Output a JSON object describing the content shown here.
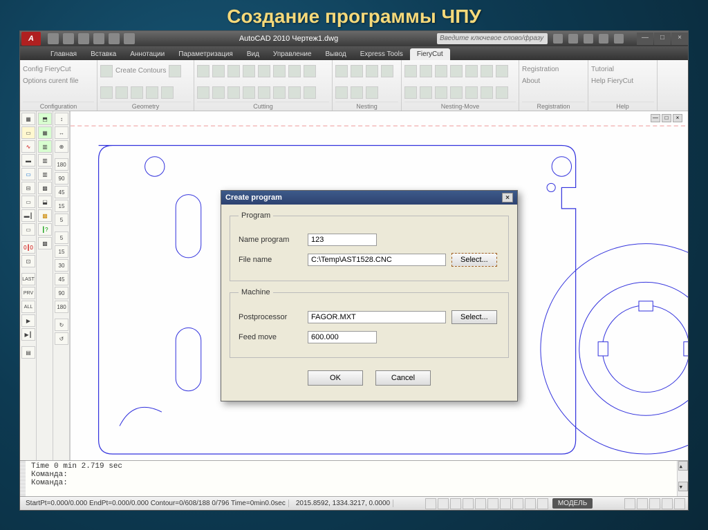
{
  "slide_title": "Создание программы ЧПУ",
  "app": {
    "title": "AutoCAD 2010    Чертеж1.dwg",
    "search_placeholder": "Введите ключевое слово/фразу"
  },
  "tabs": [
    {
      "label": "Главная"
    },
    {
      "label": "Вставка"
    },
    {
      "label": "Аннотации"
    },
    {
      "label": "Параметризация"
    },
    {
      "label": "Вид"
    },
    {
      "label": "Управление"
    },
    {
      "label": "Вывод"
    },
    {
      "label": "Express Tools"
    },
    {
      "label": "FieryCut",
      "active": true
    }
  ],
  "ribbon": {
    "groups": [
      {
        "label": "Configuration",
        "buttons": [
          "Config FieryCut",
          "Options curent file"
        ]
      },
      {
        "label": "Geometry",
        "buttons": [
          "Create Contours"
        ]
      },
      {
        "label": "Cutting"
      },
      {
        "label": "Nesting"
      },
      {
        "label": "Nesting-Move"
      },
      {
        "label": "Registration",
        "buttons": [
          "Registration",
          "About"
        ]
      },
      {
        "label": "Help",
        "buttons": [
          "Tutorial",
          "Help FieryCut"
        ]
      }
    ]
  },
  "dialog": {
    "title": "Create program",
    "group_program": "Program",
    "group_machine": "Machine",
    "name_program_label": "Name program",
    "name_program_value": "123",
    "file_name_label": "File name",
    "file_name_value": "C:\\Temp\\AST1528.CNC",
    "postprocessor_label": "Postprocessor",
    "postprocessor_value": "FAGOR.MXT",
    "feed_move_label": "Feed move",
    "feed_move_value": "600.000",
    "select_btn": "Select...",
    "ok": "OK",
    "cancel": "Cancel"
  },
  "cmd": {
    "line1": "Time  0 min 2.719 sec",
    "line2": "Команда:",
    "line3": "Команда:"
  },
  "status": {
    "seg1": "StartPt=0.000/0.000  EndPt=0.000/0.000  Contour=0/608/188  0/796  Time=0min0.0sec",
    "coords": "2015.8592, 1334.3217, 0.0000",
    "model": "МОДЕЛЬ"
  },
  "palette_labels": {
    "p3": [
      "↕",
      "↔",
      "⊕",
      "180",
      "90",
      "45",
      "15",
      "5",
      "5",
      "15",
      "30",
      "45",
      "90",
      "180",
      "↻",
      "↺"
    ]
  }
}
